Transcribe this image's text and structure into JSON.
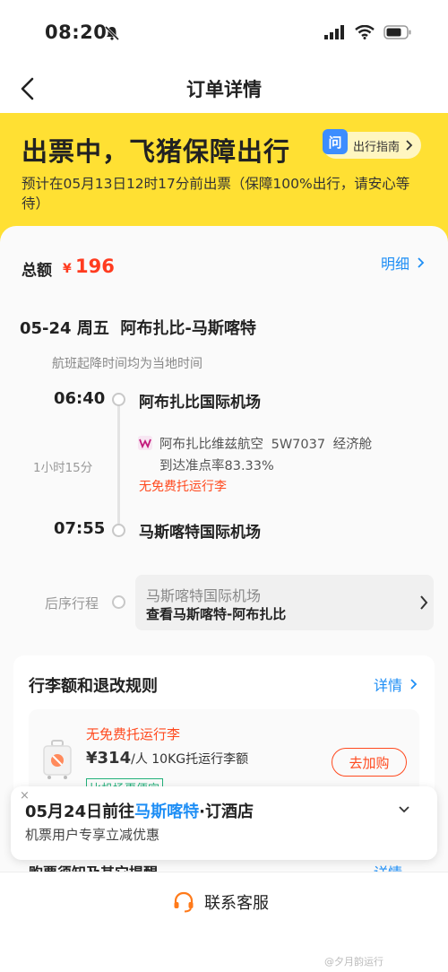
{
  "status": {
    "time": "08:20"
  },
  "nav": {
    "title": "订单详情"
  },
  "banner": {
    "title": "出票中，飞猪保障出行",
    "guide_icon": "问",
    "guide_label": "出行指南",
    "subtitle": "预计在05月13日12时17分前出票（保障100%出行，请安心等待）"
  },
  "summary": {
    "total_label": "总额",
    "currency": "¥",
    "amount": "196",
    "detail_link": "明细"
  },
  "flight": {
    "route_title": "05-24 周五  阿布扎比-马斯喀特",
    "time_note": "航班起降时间均为当地时间",
    "departure": {
      "time": "06:40",
      "airport": "阿布扎比国际机场"
    },
    "arrival": {
      "time": "07:55",
      "airport": "马斯喀特国际机场"
    },
    "duration": "1小时15分",
    "airline_info": "阿布扎比维兹航空 5W7037 经济舱",
    "on_time": "到达准点率83.33%",
    "baggage_note": "无免费托运行李"
  },
  "next_trip": {
    "label": "后序行程",
    "airport": "马斯喀特国际机场",
    "view": "查看马斯喀特-阿布扎比"
  },
  "rules": {
    "title": "行李额和退改规则",
    "detail_link": "详情",
    "baggage": {
      "no_free": "无免费托运行李",
      "price": "¥314",
      "price_suffix": "/人 10KG托运行李额",
      "buy_button": "去加购",
      "tag": "比机场更便宜"
    }
  },
  "hotel": {
    "title_prefix": "05月24日前往",
    "city": "马斯喀特",
    "title_suffix": "·订酒店",
    "subtitle": "机票用户专享立减优惠",
    "close": "×"
  },
  "notice": {
    "title": "购票须知及其它提醒",
    "link": "详情"
  },
  "bottom": {
    "contact": "联系客服"
  },
  "watermark": "@夕月韵运行",
  "colors": {
    "banner": "#ffe033",
    "price": "#ff3b1f",
    "link": "#1e8ef5",
    "warning": "#ff4a1f"
  }
}
